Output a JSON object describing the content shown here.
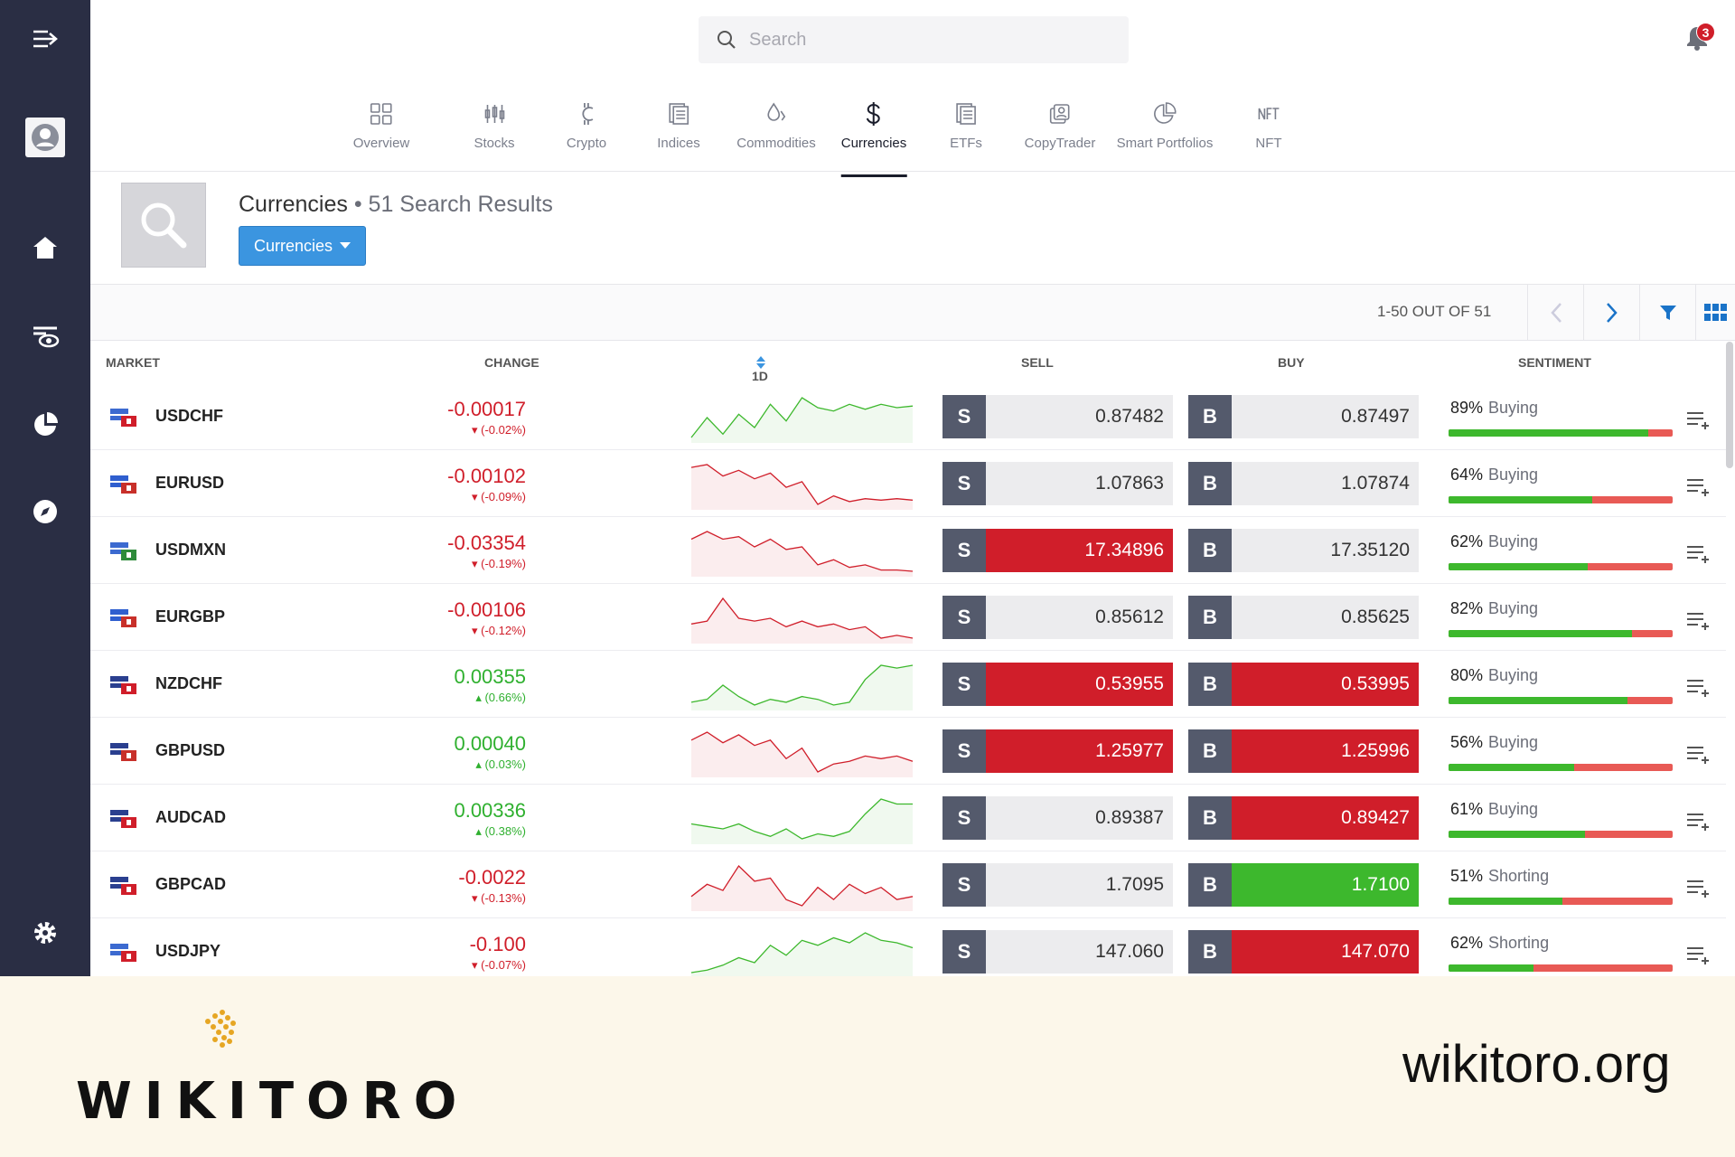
{
  "search": {
    "placeholder": "Search"
  },
  "notifications": {
    "count": "3"
  },
  "tabs": [
    {
      "label": "Overview",
      "icon": "overview-grid-icon"
    },
    {
      "label": "Stocks",
      "icon": "candlestick-icon"
    },
    {
      "label": "Crypto",
      "icon": "crypto-icon"
    },
    {
      "label": "Indices",
      "icon": "indices-icon"
    },
    {
      "label": "Commodities",
      "icon": "commodities-drop-icon"
    },
    {
      "label": "Currencies",
      "icon": "dollar-icon",
      "active": true
    },
    {
      "label": "ETFs",
      "icon": "etf-icon"
    },
    {
      "label": "CopyTrader",
      "icon": "copytrader-icon"
    },
    {
      "label": "Smart Portfolios",
      "icon": "pie-icon"
    },
    {
      "label": "NFT",
      "icon": "nft-icon"
    }
  ],
  "header": {
    "title": "Currencies",
    "separator": "•",
    "results": "51 Search Results",
    "dropdown_label": "Currencies"
  },
  "pager": {
    "text": "1-50 OUT OF 51"
  },
  "columns": {
    "market": "MARKET",
    "change": "CHANGE",
    "period": "1D",
    "sell": "SELL",
    "buy": "BUY",
    "sentiment": "SENTIMENT"
  },
  "rows": [
    {
      "market": "USDCHF",
      "change": "-0.00017",
      "change_pct": "(-0.02%)",
      "dir": "neg",
      "sell": "0.87482",
      "sell_color": "none",
      "buy": "0.87497",
      "buy_color": "none",
      "sentiment_pct": "89%",
      "sentiment_word": "Buying",
      "sentiment_fill": 0.89,
      "spark": [
        10,
        22,
        12,
        24,
        16,
        30,
        20,
        34,
        28,
        26,
        30,
        27,
        30,
        28,
        29
      ],
      "spark_dir": "pos"
    },
    {
      "market": "EURUSD",
      "change": "-0.00102",
      "change_pct": "(-0.09%)",
      "dir": "neg",
      "sell": "1.07863",
      "sell_color": "none",
      "buy": "1.07874",
      "buy_color": "none",
      "sentiment_pct": "64%",
      "sentiment_word": "Buying",
      "sentiment_fill": 0.64,
      "spark": [
        34,
        36,
        28,
        32,
        26,
        30,
        20,
        24,
        8,
        14,
        10,
        12,
        11,
        12,
        11
      ],
      "spark_dir": "neg"
    },
    {
      "market": "USDMXN",
      "change": "-0.03354",
      "change_pct": "(-0.19%)",
      "dir": "neg",
      "sell": "17.34896",
      "sell_color": "red",
      "buy": "17.35120",
      "buy_color": "none",
      "sentiment_pct": "62%",
      "sentiment_word": "Buying",
      "sentiment_fill": 0.62,
      "spark": [
        30,
        36,
        30,
        32,
        24,
        30,
        22,
        24,
        10,
        14,
        8,
        10,
        6,
        6,
        5
      ],
      "spark_dir": "neg"
    },
    {
      "market": "EURGBP",
      "change": "-0.00106",
      "change_pct": "(-0.12%)",
      "dir": "neg",
      "sell": "0.85612",
      "sell_color": "none",
      "buy": "0.85625",
      "buy_color": "none",
      "sentiment_pct": "82%",
      "sentiment_word": "Buying",
      "sentiment_fill": 0.82,
      "spark": [
        20,
        22,
        38,
        24,
        22,
        24,
        18,
        22,
        18,
        20,
        16,
        18,
        10,
        12,
        10
      ],
      "spark_dir": "neg"
    },
    {
      "market": "NZDCHF",
      "change": "0.00355",
      "change_pct": "(0.66%)",
      "dir": "pos",
      "sell": "0.53955",
      "sell_color": "red",
      "buy": "0.53995",
      "buy_color": "red",
      "sentiment_pct": "80%",
      "sentiment_word": "Buying",
      "sentiment_fill": 0.8,
      "spark": [
        14,
        16,
        26,
        18,
        12,
        16,
        14,
        18,
        16,
        12,
        14,
        30,
        40,
        38,
        40
      ],
      "spark_dir": "pos"
    },
    {
      "market": "GBPUSD",
      "change": "0.00040",
      "change_pct": "(0.03%)",
      "dir": "pos",
      "sell": "1.25977",
      "sell_color": "red",
      "buy": "1.25996",
      "buy_color": "red",
      "sentiment_pct": "56%",
      "sentiment_word": "Buying",
      "sentiment_fill": 0.56,
      "spark": [
        30,
        36,
        28,
        34,
        26,
        30,
        16,
        24,
        6,
        12,
        14,
        18,
        16,
        18,
        14
      ],
      "spark_dir": "neg"
    },
    {
      "market": "AUDCAD",
      "change": "0.00336",
      "change_pct": "(0.38%)",
      "dir": "pos",
      "sell": "0.89387",
      "sell_color": "none",
      "buy": "0.89427",
      "buy_color": "red",
      "sentiment_pct": "61%",
      "sentiment_word": "Buying",
      "sentiment_fill": 0.61,
      "spark": [
        20,
        18,
        16,
        20,
        14,
        10,
        16,
        8,
        12,
        10,
        14,
        28,
        40,
        36,
        36
      ],
      "spark_dir": "pos"
    },
    {
      "market": "GBPCAD",
      "change": "-0.0022",
      "change_pct": "(-0.13%)",
      "dir": "neg",
      "sell": "1.7095",
      "sell_color": "none",
      "buy": "1.7100",
      "buy_color": "green",
      "sentiment_pct": "51%",
      "sentiment_word": "Shorting",
      "sentiment_fill": 0.51,
      "spark": [
        16,
        24,
        20,
        36,
        26,
        28,
        14,
        10,
        22,
        14,
        24,
        18,
        22,
        14,
        16
      ],
      "spark_dir": "neg"
    },
    {
      "market": "USDJPY",
      "change": "-0.100",
      "change_pct": "(-0.07%)",
      "dir": "neg",
      "sell": "147.060",
      "sell_color": "none",
      "buy": "147.070",
      "buy_color": "red",
      "sentiment_pct": "62%",
      "sentiment_word": "Shorting",
      "sentiment_fill": 0.38,
      "spark": [
        4,
        6,
        10,
        16,
        12,
        26,
        18,
        30,
        26,
        32,
        28,
        36,
        30,
        28,
        24
      ],
      "spark_dir": "pos"
    }
  ],
  "footer": {
    "brand": "WIKITORO",
    "site": "wikitoro.org"
  },
  "colors": {
    "sidebar": "#2a2e44",
    "negative": "#d01e2a",
    "positive": "#2fb02f",
    "accent": "#3b95e0"
  }
}
